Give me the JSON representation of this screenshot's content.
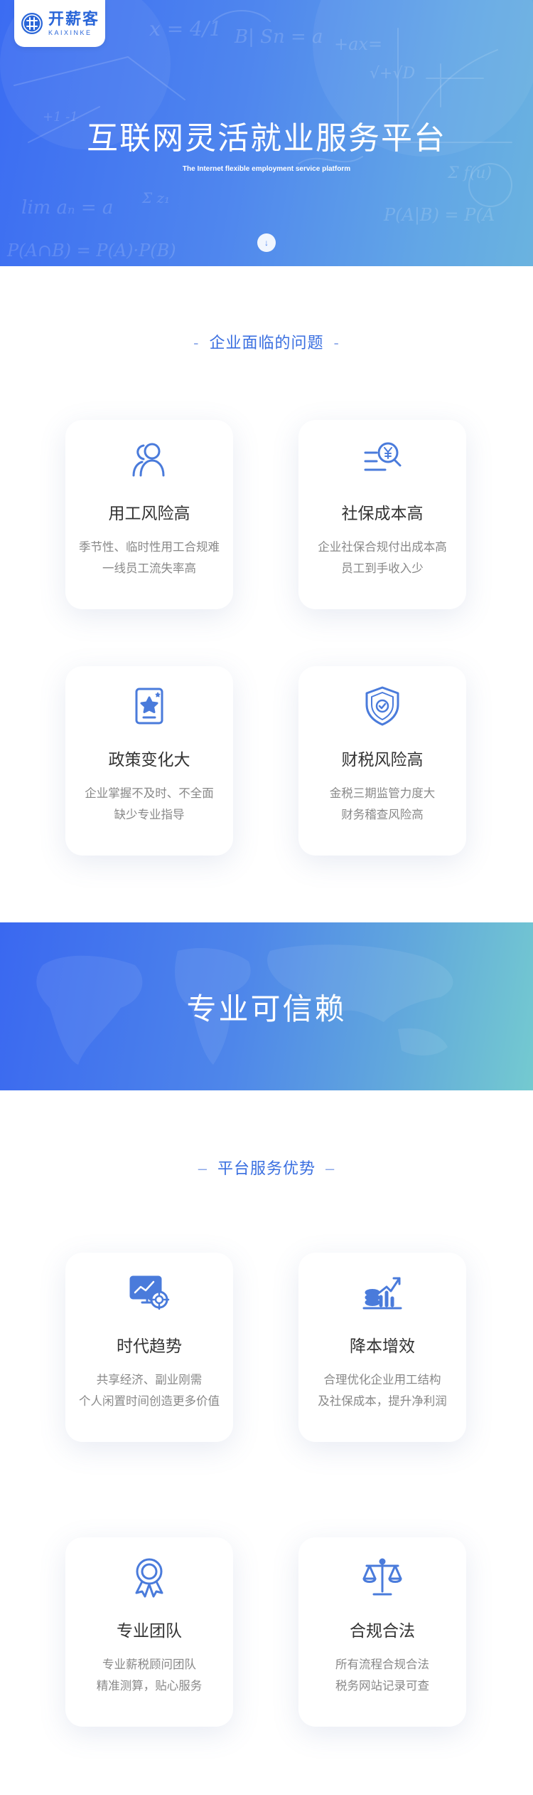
{
  "brand": {
    "name_cn": "开薪客",
    "name_en": "KAIXINKE"
  },
  "hero": {
    "title": "互联网灵活就业服务平台",
    "subtitle": "The Internet flexible employment service platform",
    "scroll_icon": "↓",
    "accent": "#4f86ee"
  },
  "problems": {
    "title": "企业面临的问题",
    "title_dash": "-",
    "cards": [
      {
        "icon": "users-icon",
        "title": "用工风险高",
        "line1": "季节性、临时性用工合规难",
        "line2": "一线员工流失率高"
      },
      {
        "icon": "money-search-icon",
        "title": "社保成本高",
        "line1": "企业社保合规付出成本高",
        "line2": "员工到手收入少"
      },
      {
        "icon": "policy-badge-icon",
        "title": "政策变化大",
        "line1": "企业掌握不及时、不全面",
        "line2": "缺少专业指导"
      },
      {
        "icon": "shield-check-icon",
        "title": "财税风险高",
        "line1": "金税三期监管力度大",
        "line2": "财务稽查风险高"
      }
    ]
  },
  "banner": {
    "title": "专业可信赖"
  },
  "advantages": {
    "title": "平台服务优势",
    "title_dash": "–",
    "cards": [
      {
        "icon": "trend-monitor-icon",
        "title": "时代趋势",
        "line1": "共享经济、副业刚需",
        "line2": "个人闲置时间创造更多价值"
      },
      {
        "icon": "coins-growth-icon",
        "title": "降本增效",
        "line1": "合理优化企业用工结构",
        "line2": "及社保成本，提升净利润"
      },
      {
        "icon": "award-ribbon-icon",
        "title": "专业团队",
        "line1": "专业薪税顾问团队",
        "line2": "精准测算，贴心服务"
      },
      {
        "icon": "balance-scale-icon",
        "title": "合规合法",
        "line1": "所有流程合规合法",
        "line2": "税务网站记录可查"
      }
    ]
  },
  "colors": {
    "brand_blue": "#2a66d8",
    "section_title": "#3a6fe0",
    "icon_blue": "#4a7bdb",
    "text_dark": "#333333",
    "text_gray": "#888888"
  }
}
